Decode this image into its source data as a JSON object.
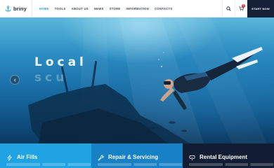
{
  "header": {
    "logo_text": "briny",
    "nav": [
      "HOME",
      "TOOLS",
      "ABOUT US",
      "NEWS",
      "STORE",
      "INFORMATION",
      "CONTACTS"
    ],
    "active_nav": "HOME",
    "cart_count": "1",
    "cta_label": "START NOW"
  },
  "hero": {
    "title": "Local",
    "subtitle": "scu"
  },
  "features": [
    {
      "title": "Air Fills",
      "icon": "lightning-icon"
    },
    {
      "title": "Repair & Servicing",
      "icon": "wrench-icon"
    },
    {
      "title": "Rental Equipment",
      "icon": "diving-helmet-icon"
    }
  ],
  "colors": {
    "accent": "#1ca3e0",
    "dark": "#142035",
    "feature1": "#1fa3e3",
    "feature2": "#1781c5",
    "feature3": "#111d33",
    "badge": "#e02a35"
  }
}
